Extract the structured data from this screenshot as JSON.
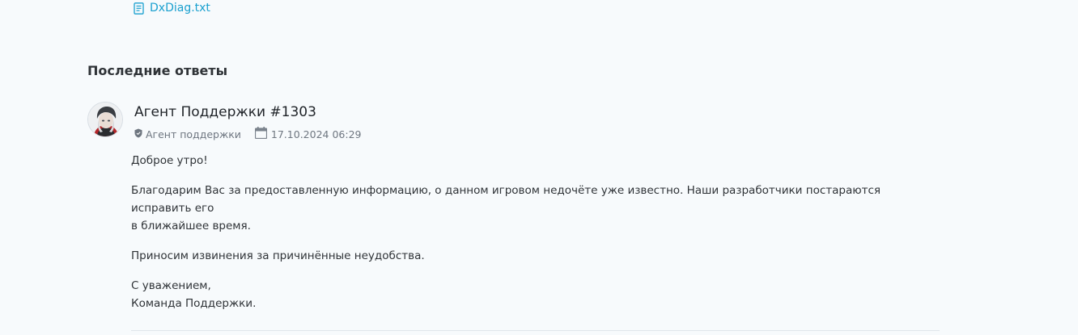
{
  "attachment": {
    "filename": "DxDiag.txt"
  },
  "section": {
    "title": "Последние ответы"
  },
  "reply": {
    "author": "Агент Поддержки #1303",
    "role": "Агент поддержки",
    "date": "17.10.2024 06:29",
    "paragraphs": {
      "greeting": "Доброе утро!",
      "body_line1": "Благодарим Вас за предоставленную информацию, о данном игровом недочёте уже известно. Наши разработчики постараются исправить его",
      "body_line2": "в ближайшее время.",
      "apology": "Приносим извинения за причинённые неудобства.",
      "signoff_line1": "С уважением,",
      "signoff_line2": "Команда Поддержки."
    }
  },
  "icons": {
    "file": "file-text-icon",
    "shield": "shield-icon",
    "calendar": "calendar-icon"
  },
  "colors": {
    "background": "#f7fafc",
    "link": "#1aa0cf",
    "muted": "#6e7680",
    "text": "#2f3337"
  }
}
